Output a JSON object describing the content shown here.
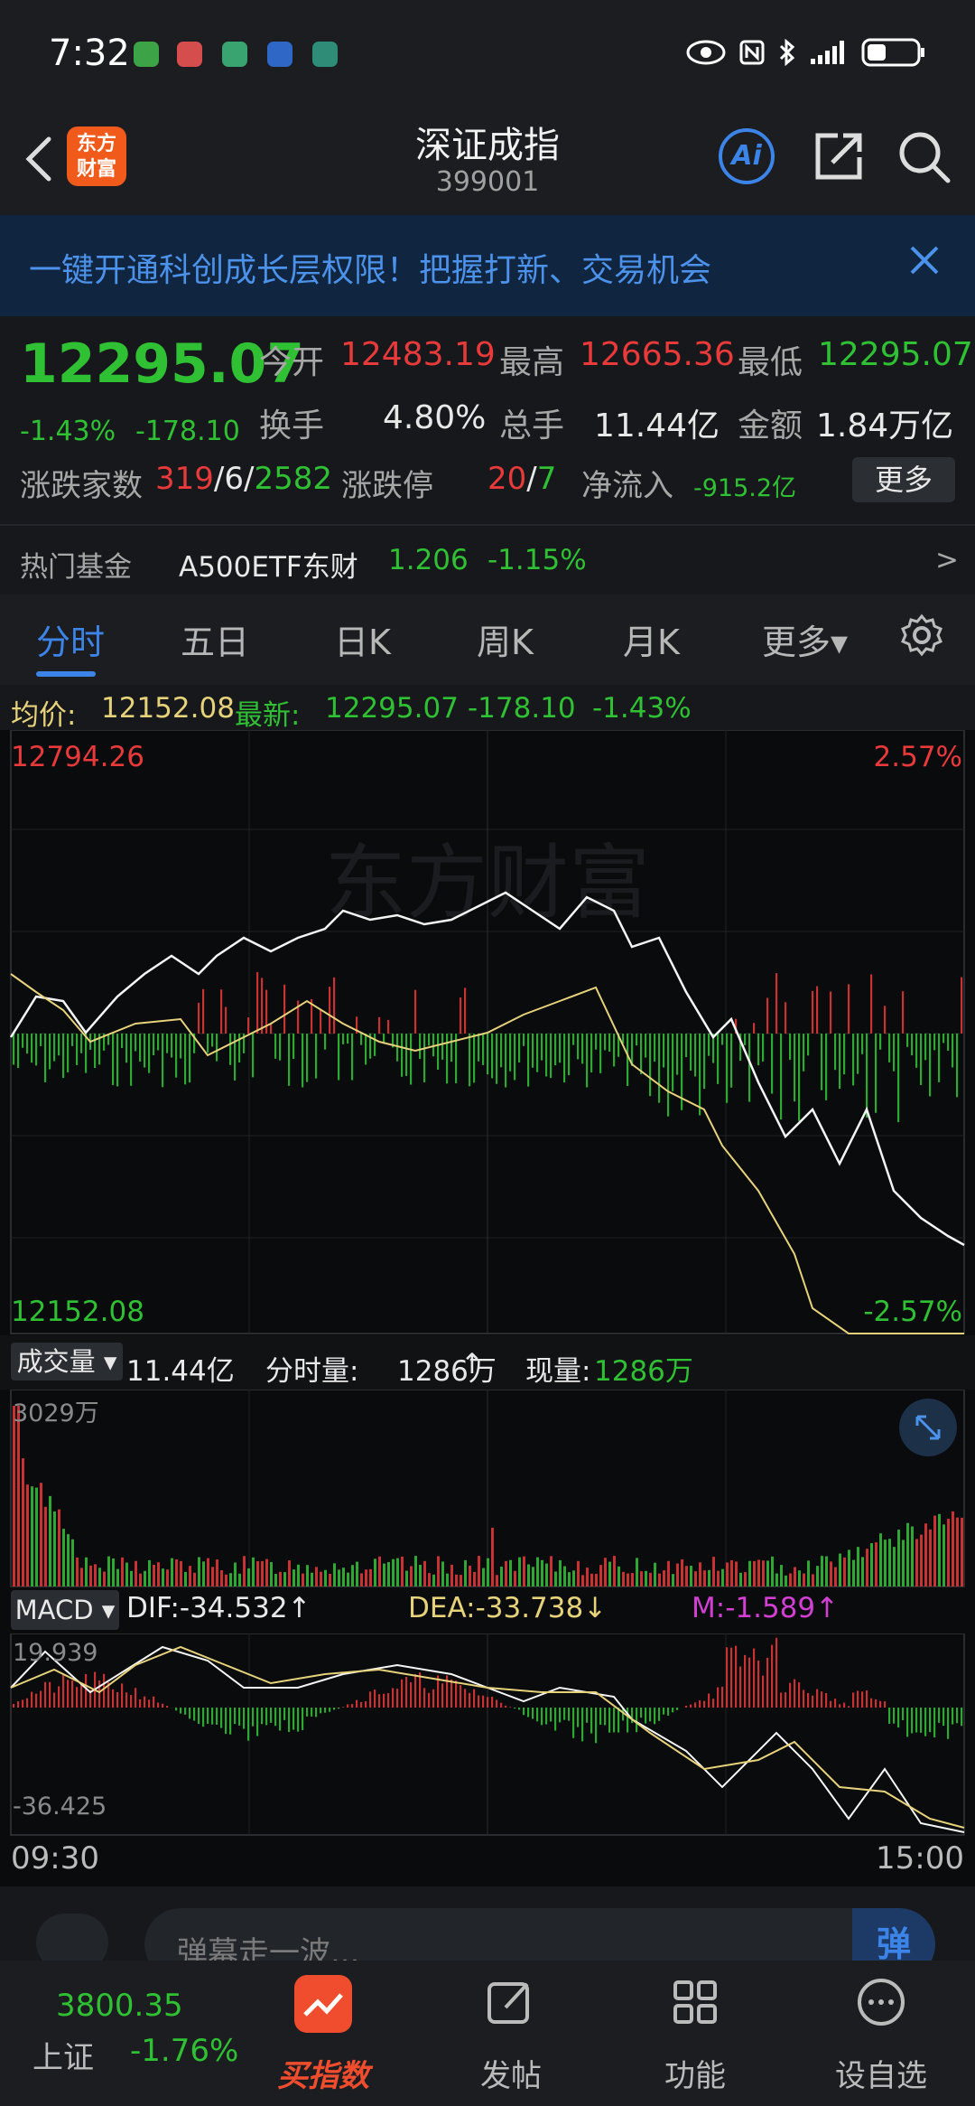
{
  "status_bar": {
    "time": "7:32"
  },
  "header": {
    "title": "深证成指",
    "code": "399001",
    "logo_text": "东方\n财富",
    "ai_label": "Ai"
  },
  "banner": {
    "text": "一键开通科创成长层权限！把握打新、交易机会"
  },
  "quote": {
    "price": "12295.07",
    "change_pct": "-1.43%",
    "change_val": "-178.10",
    "open_label": "今开",
    "open": "12483.19",
    "high_label": "最高",
    "high": "12665.36",
    "low_label": "最低",
    "low": "12295.07",
    "turnover_label": "换手",
    "turnover": "4.80%",
    "volume_label": "总手",
    "volume": "11.44亿",
    "amount_label": "金额",
    "amount": "1.84万亿",
    "breadth_label": "涨跌家数",
    "breadth_up": "319",
    "breadth_flat": "/6/",
    "breadth_down": "2582",
    "limit_label": "涨跌停",
    "limit_up": "20",
    "limit_sep": "/",
    "limit_down": "7",
    "netflow_label": "净流入",
    "netflow": "-915.2亿",
    "more_button": "更多",
    "fund_label": "热门基金",
    "fund_name": "A500ETF东财",
    "fund_price": "1.206",
    "fund_change": "-1.15%",
    "fund_arrow": ">"
  },
  "tabs": [
    "分时",
    "五日",
    "日K",
    "周K",
    "月K",
    "更多▾"
  ],
  "chart_head": {
    "avg_label": "均价:",
    "avg": "12152.08",
    "last_label": "最新:",
    "last": "12295.07",
    "chg": "-178.10",
    "pct": "-1.43%"
  },
  "chart_axes": {
    "y_top": "12794.26",
    "y_bottom": "12152.08",
    "pct_top": "2.57%",
    "pct_bottom": "-2.57%",
    "watermark": "东方财富"
  },
  "volume": {
    "pill": "成交量 ▾",
    "total": "11.44亿",
    "minute_label": "分时量:",
    "minute": "1286万",
    "minute_arrow": "↑",
    "current_label": "现量:",
    "current": "1286万",
    "y_max": "3029万"
  },
  "macd": {
    "pill": "MACD ▾",
    "dif": "DIF:-34.532↑",
    "dea": "DEA:-33.738↓",
    "m": "M:-1.589↑",
    "y_top": "19.939",
    "y_bottom": "-36.425"
  },
  "time_axis": {
    "start": "09:30",
    "end": "15:00"
  },
  "comment": {
    "placeholder": "弹幕走一波...",
    "danmu": "弹"
  },
  "bottom_nav": {
    "index_value": "3800.35",
    "index_name": "上证",
    "index_change": "-1.76%",
    "buy_label": "买指数",
    "post_label": "发帖",
    "func_label": "功能",
    "settings_label": "设自选"
  },
  "colors": {
    "up": "#e83a3a",
    "down": "#2fc133",
    "accent": "#3d84e8",
    "avg_line": "#e6d27a"
  }
}
